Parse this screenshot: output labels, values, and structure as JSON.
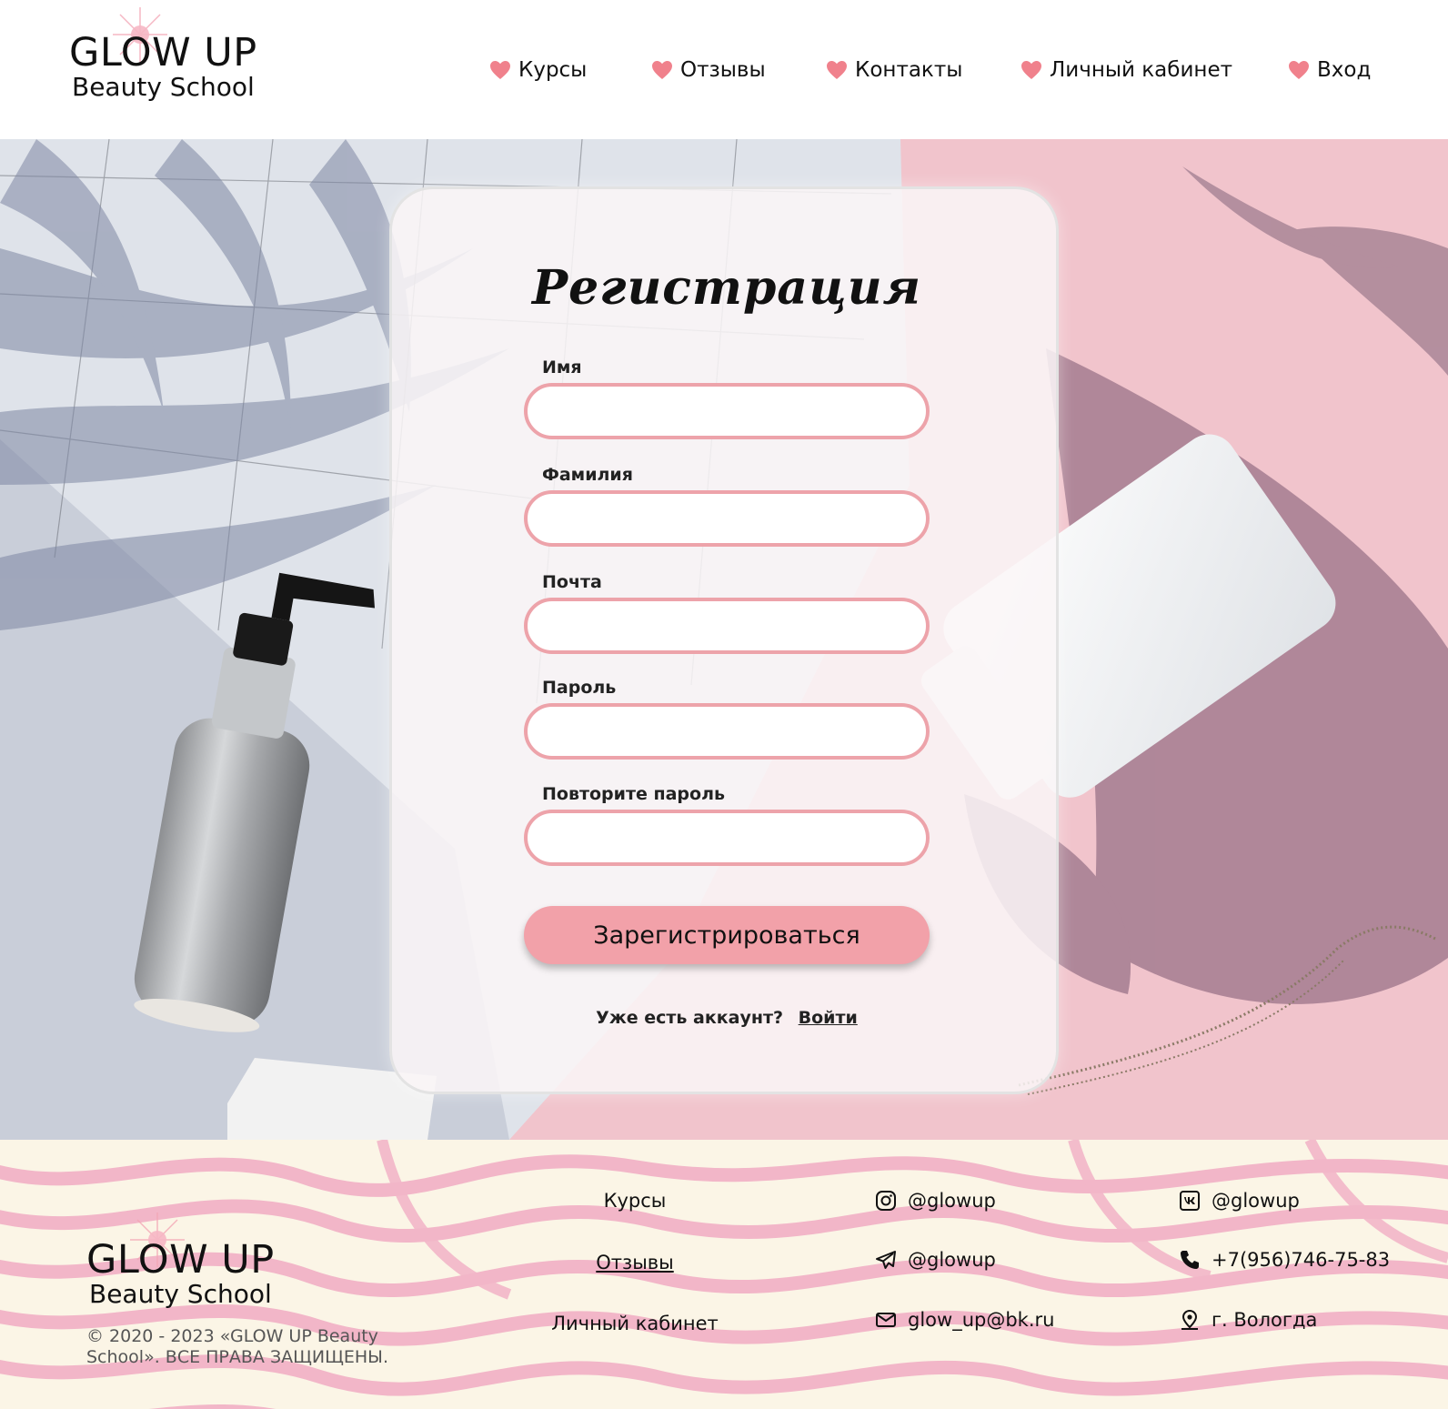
{
  "brand": {
    "title": "GLOW UP",
    "subtitle": "Beauty School",
    "accent_color": "#f2a1a9",
    "heart_color": "#f0818c"
  },
  "nav": {
    "items": [
      {
        "label": "Курсы",
        "icon": "heart-icon"
      },
      {
        "label": "Отзывы",
        "icon": "heart-icon"
      },
      {
        "label": "Контакты",
        "icon": "heart-icon"
      },
      {
        "label": "Личный кабинет",
        "icon": "heart-icon"
      },
      {
        "label": "Вход",
        "icon": "heart-icon"
      }
    ]
  },
  "form": {
    "title": "Регистрация",
    "fields": [
      {
        "label": "Имя",
        "value": "",
        "placeholder": ""
      },
      {
        "label": "Фамилия",
        "value": "",
        "placeholder": ""
      },
      {
        "label": "Почта",
        "value": "",
        "placeholder": ""
      },
      {
        "label": "Пароль",
        "value": "",
        "placeholder": ""
      },
      {
        "label": "Повторите пароль",
        "value": "",
        "placeholder": ""
      }
    ],
    "submit_label": "Зарегистрироваться",
    "have_account_text": "Уже есть аккаунт?",
    "login_link": "Войти"
  },
  "footer": {
    "copyright": "© 2020 - 2023 «GLOW UP Beauty School». ВСЕ ПРАВА ЗАЩИЩЕНЫ.",
    "links": [
      "Курсы",
      "Отзывы",
      "Личный кабинет"
    ],
    "contacts": [
      {
        "icon": "instagram-icon",
        "text": "@glowup"
      },
      {
        "icon": "telegram-icon",
        "text": "@glowup"
      },
      {
        "icon": "mail-icon",
        "text": "glow_up@bk.ru"
      },
      {
        "icon": "vk-icon",
        "text": "@glowup"
      },
      {
        "icon": "phone-icon",
        "text": "+7(956)746-75-83"
      },
      {
        "icon": "location-icon",
        "text": "г. Вологда"
      }
    ]
  }
}
